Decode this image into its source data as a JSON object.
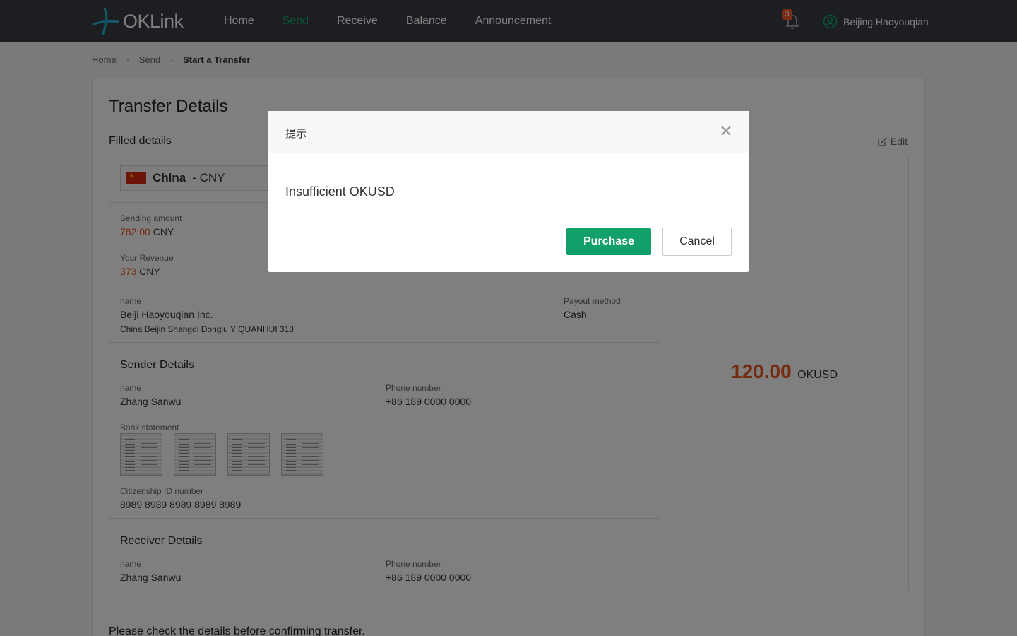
{
  "header": {
    "logo_text": "OKLink",
    "nav": [
      "Home",
      "Send",
      "Receive",
      "Balance",
      "Announcement"
    ],
    "active_nav": "Send",
    "notification_count": "3",
    "user_name": "Beijing  Haoyouqian",
    "accent_color": "#13a46a"
  },
  "breadcrumb": {
    "items": [
      "Home",
      "Send"
    ],
    "current": "Start a Transfer"
  },
  "page": {
    "title": "Transfer Details",
    "filled_title": "Filled details",
    "edit_label": "Edit",
    "footer_note": "Please check the details before confirming transfer."
  },
  "country": {
    "name": "China",
    "currency": "- CNY"
  },
  "amounts": {
    "sending_label": "Sending amount",
    "sending_value": "782.00",
    "sending_unit": "CNY",
    "revenue_label": "Your Revenue",
    "revenue_value": "373",
    "revenue_unit": "CNY",
    "total_value": "120.00",
    "total_unit": "OKUSD"
  },
  "recipient": {
    "name_label": "name",
    "name": "Beiji Haoyouqian Inc.",
    "address": "China  Beijin  Shangdi Donglu YIQUANHUI 318",
    "payout_label": "Payout method",
    "payout_value": "Cash"
  },
  "sender": {
    "title": "Sender Details",
    "name_label": "name",
    "name": "Zhang Sanwu",
    "phone_label": "Phone number",
    "phone": "+86 189 0000 0000",
    "bank_label": "Bank statement",
    "id_label": "Citizenship ID number",
    "id_number": "8989 8989 8989 8989 8989"
  },
  "receiver": {
    "title": "Receiver Details",
    "name_label": "name",
    "name": "Zhang Sanwu",
    "phone_label": "Phone number",
    "phone": "+86 189 0000 0000"
  },
  "dialog": {
    "title": "提示",
    "message": "Insufficient OKUSD",
    "primary_label": "Purchase",
    "cancel_label": "Cancel",
    "primary_color": "#12a06a"
  }
}
